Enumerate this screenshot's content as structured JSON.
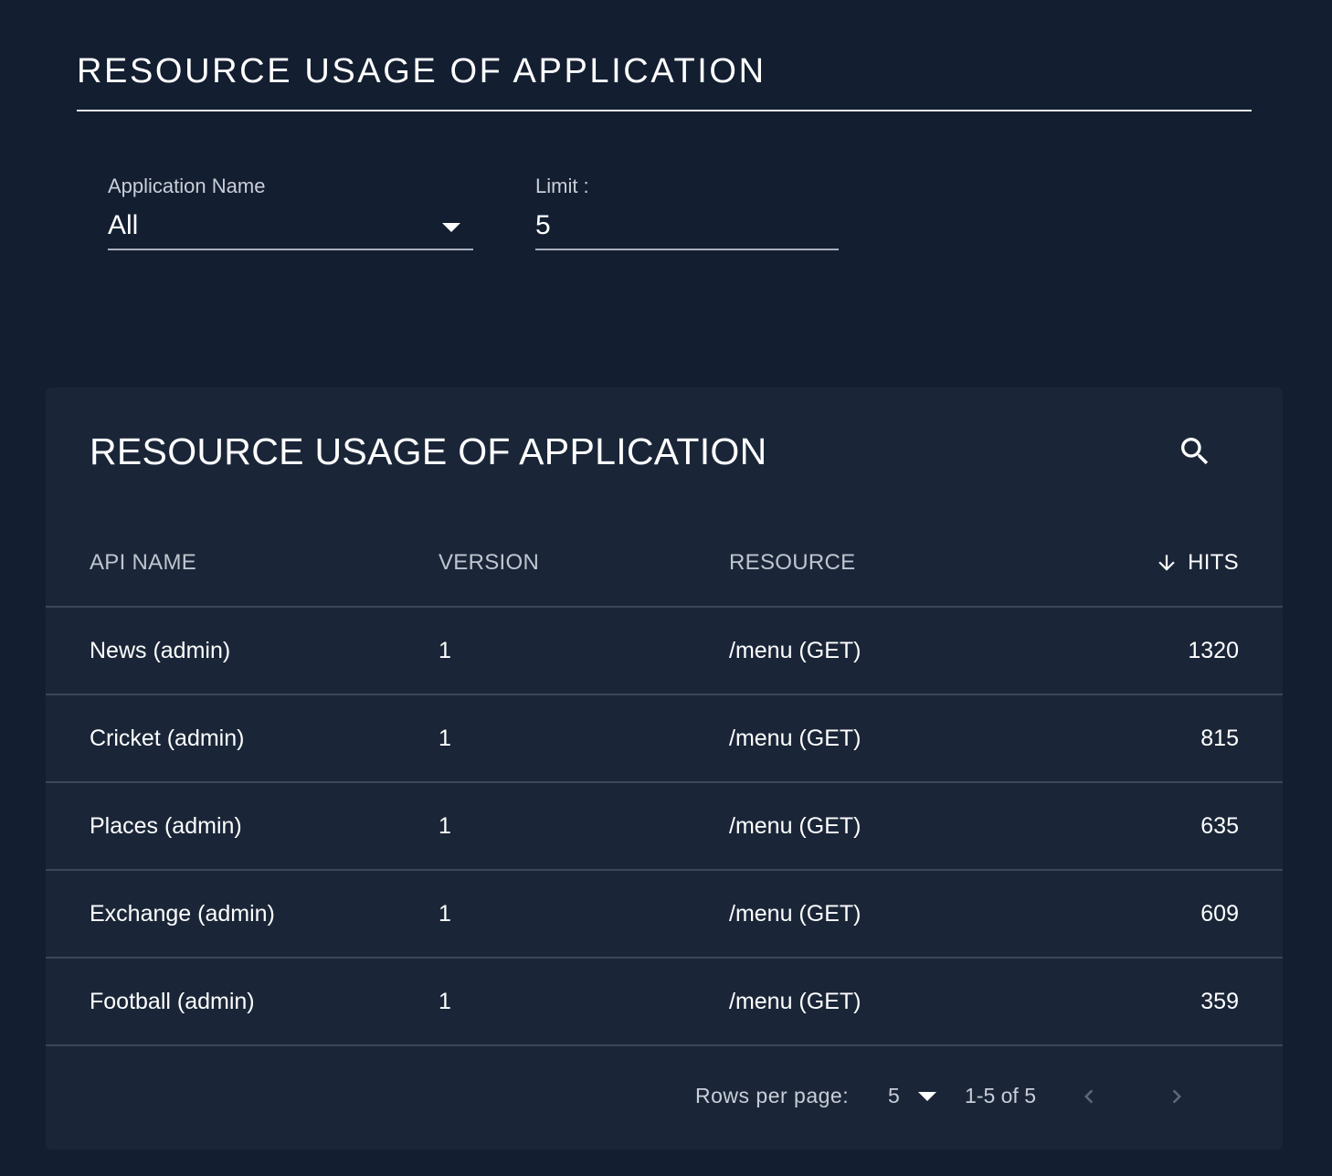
{
  "header": {
    "title": "RESOURCE USAGE OF APPLICATION"
  },
  "filters": {
    "application": {
      "label": "Application Name",
      "value": "All"
    },
    "limit": {
      "label": "Limit :",
      "value": "5"
    }
  },
  "card": {
    "title": "RESOURCE USAGE OF APPLICATION",
    "search_icon": "search-icon"
  },
  "table": {
    "columns": [
      "API NAME",
      "VERSION",
      "RESOURCE",
      "HITS"
    ],
    "sort": {
      "column": "HITS",
      "direction": "desc",
      "icon": "arrow-down-icon"
    },
    "rows": [
      {
        "api_name": "News (admin)",
        "version": "1",
        "resource": "/menu (GET)",
        "hits": "1320"
      },
      {
        "api_name": "Cricket (admin)",
        "version": "1",
        "resource": "/menu (GET)",
        "hits": "815"
      },
      {
        "api_name": "Places (admin)",
        "version": "1",
        "resource": "/menu (GET)",
        "hits": "635"
      },
      {
        "api_name": "Exchange (admin)",
        "version": "1",
        "resource": "/menu (GET)",
        "hits": "609"
      },
      {
        "api_name": "Football (admin)",
        "version": "1",
        "resource": "/menu (GET)",
        "hits": "359"
      }
    ]
  },
  "pagination": {
    "rows_per_page_label": "Rows per page:",
    "rows_per_page_value": "5",
    "range_text": "1-5 of 5"
  },
  "colors": {
    "background": "#131e31",
    "card": "#1a2638",
    "divider": "#3c4656",
    "text": "#ffffff",
    "muted_text": "#c9ced8"
  }
}
